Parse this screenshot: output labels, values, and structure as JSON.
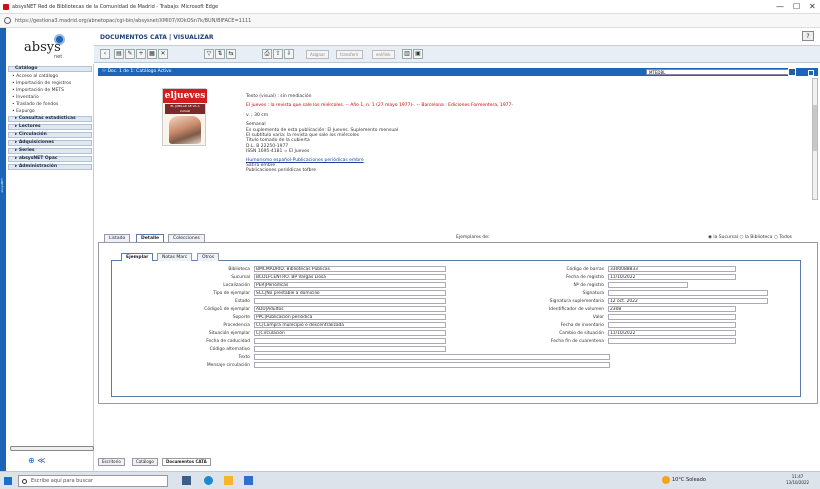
{
  "browser": {
    "title": "absysNET Red de Bibliotecas de la Comunidad de Madrid - Trabajo: Microsoft Edge",
    "url": "https://gestiona3.madrid.org/abnetopac/cgi-bin/absysnet/XMI07/XOkOSn7k/BUN/BIFACE=1111",
    "minimize": "—",
    "maximize": "☐",
    "close": "✕"
  },
  "logo": {
    "text": "absys",
    "sub": "net"
  },
  "header": {
    "module": "DOCUMENTOS CATA  |  VISUALIZAR",
    "help": "?"
  },
  "toolbar": {
    "asignar": "Asignar",
    "transferir": "transferir",
    "enlink": "enl/link"
  },
  "sidebar": {
    "sections": [
      {
        "label": "Catálogo",
        "items": [
          "Acceso al catálogo",
          "Importación de registros",
          "Importación de METS",
          "Inventario",
          "Traslado de fondos",
          "Expurgo"
        ]
      },
      {
        "label": "Consultas estadísticas",
        "items": []
      }
    ],
    "modules": [
      "Lectores",
      "Circulación",
      "Adquisiciones",
      "Series",
      "absysNET Opac",
      "Administración"
    ],
    "nav": "⊕ ≪"
  },
  "record": {
    "bar_label": "☉ Doc. 1 de 1: Catálogo Activo",
    "select_value": "MTEDBL",
    "cover_title": "eljueves",
    "cover_subtitle": "EL JUBILAR SE VA A CASAR",
    "lines": [
      {
        "text": "Texto (visual) : sin mediación",
        "style": "plain"
      },
      {
        "text": "El jueves : la revista que sale los miércoles. -- Año 1, n. 1 (27 mayo 1977)-. -- Barcelona : Ediciones Formentera, 1977-",
        "style": "red"
      },
      {
        "text": "v. ; 30 cm",
        "style": "plain"
      },
      {
        "text": "Semanal",
        "style": "plain"
      },
      {
        "text": "Es suplemento de esta publicación: El Jueves. Suplemento mensual",
        "style": "plain"
      },
      {
        "text": "El subtítulo varía: la revista que sale los miércoles",
        "style": "plain"
      },
      {
        "text": "Título tomado de la cubierta",
        "style": "plain"
      },
      {
        "text": "D.L. B 22250-1977",
        "style": "plain"
      },
      {
        "text": "ISSN 1695-4181 = El Jueves",
        "style": "plain"
      },
      {
        "text": "Humorismo español-Publicaciones periódicas embre",
        "style": "link"
      },
      {
        "text": "Sátira embre",
        "style": "plain"
      },
      {
        "text": "Publicaciones periódicas tofbre",
        "style": "plain"
      }
    ]
  },
  "tabs": {
    "top": [
      "Listado",
      "Detalle",
      "Colecciones"
    ],
    "inner": [
      "Ejemplar",
      "Notas Marc",
      "Otros"
    ]
  },
  "ejemplares": {
    "label": "Ejemplares de:",
    "scope_options": [
      "la Sucursal",
      "la Biblioteca",
      "Todos"
    ],
    "pager": "1/138"
  },
  "ejemplar": {
    "left": [
      {
        "label": "Biblioteca",
        "value": "BMCMADRID. Bibliotecas Públicas"
      },
      {
        "label": "Sucursal",
        "value": "BCOLFCENTRO. BP Vargas Llosa"
      },
      {
        "label": "Localización",
        "value": "PER|Periódicas"
      },
      {
        "label": "Tipo de ejemplar",
        "value": "SCC|No prestable a domicilio"
      },
      {
        "label": "Estado",
        "value": ""
      },
      {
        "label": "Código1 de ejemplar",
        "value": "ADU|Adultos"
      },
      {
        "label": "Soporte",
        "value": "PPC|Publicación periódica"
      },
      {
        "label": "Procedencia",
        "value": "CC|Compra municipio o descentralizada"
      },
      {
        "label": "Situación ejemplar",
        "value": "C|Circulación"
      },
      {
        "label": "Fecha de caducidad",
        "value": ""
      },
      {
        "label": "Código alternativo",
        "value": ""
      },
      {
        "label": "Texto",
        "value": ""
      },
      {
        "label": "Mensaje circulación",
        "value": ""
      }
    ],
    "right": [
      {
        "label": "Código de barras",
        "value": "3300088833"
      },
      {
        "label": "Fecha de registro",
        "value": "11/10/2022"
      },
      {
        "label": "Nº de registro",
        "value": ""
      },
      {
        "label": "Signatura",
        "value": ""
      },
      {
        "label": "Signatura suplementaria",
        "value": "12 oct. 2022"
      },
      {
        "label": "Identificador de volumen",
        "value": "2308"
      },
      {
        "label": "Valor",
        "value": ""
      },
      {
        "label": "Fecha de inventario",
        "value": ""
      },
      {
        "label": "Cambio de situación",
        "value": "11/10/2022"
      },
      {
        "label": "Fecha fin de cuarentena",
        "value": ""
      }
    ]
  },
  "bottom_tabs": [
    "Escritorio",
    "Catálogo",
    "Documentos CATA"
  ],
  "taskbar": {
    "search_placeholder": "Escribe aquí para buscar",
    "weather": "10°C Soleado",
    "time": "11:47",
    "date": "13/10/2022"
  }
}
